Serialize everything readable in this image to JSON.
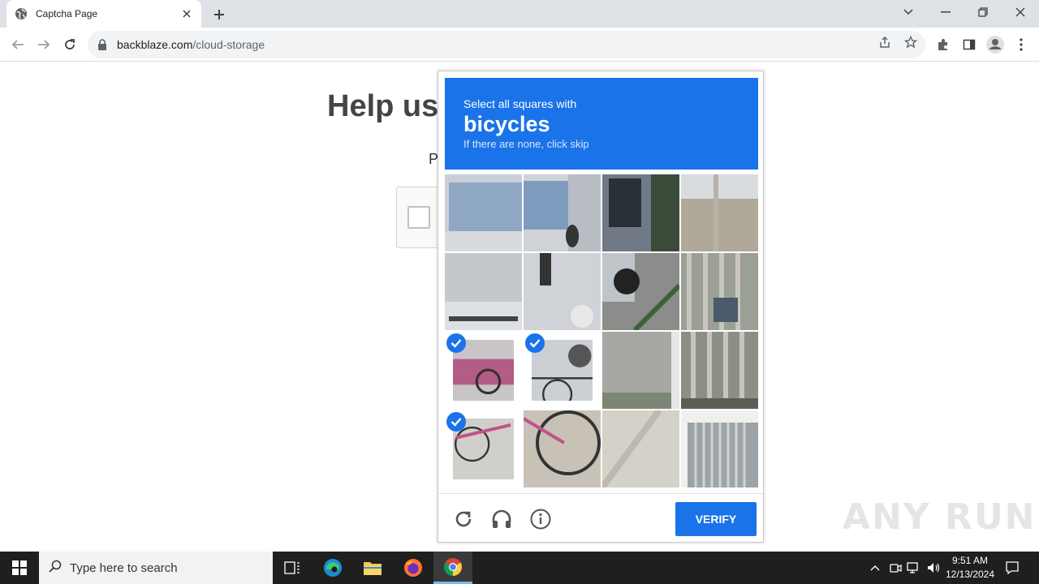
{
  "browser": {
    "tab_title": "Captcha Page",
    "url_host": "backblaze.com",
    "url_path": "/cloud-storage"
  },
  "page": {
    "heading": "Help us",
    "subtext": "P"
  },
  "captcha": {
    "instruction": "Select all squares with",
    "target": "bicycles",
    "hint": "If there are none, click skip",
    "verify_label": "VERIFY",
    "accent_color": "#1a73e8",
    "tiles": [
      {
        "name": "tile-1-1",
        "selected": false
      },
      {
        "name": "tile-1-2",
        "selected": false
      },
      {
        "name": "tile-1-3",
        "selected": false
      },
      {
        "name": "tile-1-4",
        "selected": false
      },
      {
        "name": "tile-2-1",
        "selected": false
      },
      {
        "name": "tile-2-2",
        "selected": false
      },
      {
        "name": "tile-2-3",
        "selected": false
      },
      {
        "name": "tile-2-4",
        "selected": false
      },
      {
        "name": "tile-3-1",
        "selected": true
      },
      {
        "name": "tile-3-2",
        "selected": true
      },
      {
        "name": "tile-3-3",
        "selected": false
      },
      {
        "name": "tile-3-4",
        "selected": false
      },
      {
        "name": "tile-4-1",
        "selected": true
      },
      {
        "name": "tile-4-2",
        "selected": false
      },
      {
        "name": "tile-4-3",
        "selected": false
      },
      {
        "name": "tile-4-4",
        "selected": false
      }
    ]
  },
  "watermark": "ANY RUN",
  "taskbar": {
    "search_placeholder": "Type here to search",
    "time": "9:51 AM",
    "date": "12/13/2024"
  }
}
